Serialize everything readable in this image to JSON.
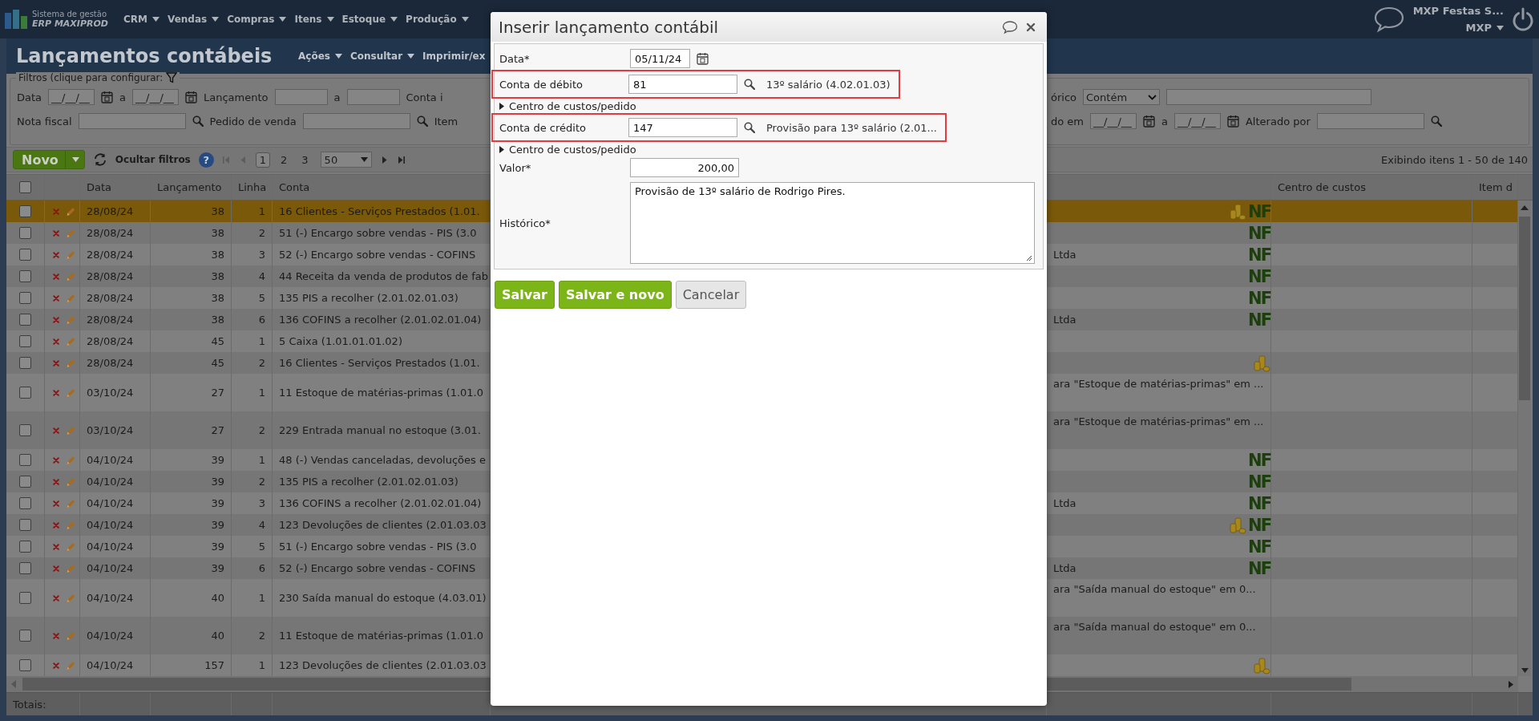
{
  "top_bar": {
    "logo_caption": "Sistema de gestão",
    "logo_name": "ERP MAXIPROD",
    "menu": [
      {
        "label": "CRM"
      },
      {
        "label": "Vendas"
      },
      {
        "label": "Compras"
      },
      {
        "label": "Itens"
      },
      {
        "label": "Estoque"
      },
      {
        "label": "Produção"
      }
    ],
    "company": "MXP Festas S...",
    "user": "MXP"
  },
  "page_header": {
    "title": "Lançamentos contábeis",
    "menu": [
      {
        "label": "Ações",
        "dropdown": true
      },
      {
        "label": "Consultar",
        "dropdown": true
      },
      {
        "label": "Imprimir/ex",
        "dropdown": false
      }
    ]
  },
  "filters": {
    "legend": "Filtros (clique para configurar:",
    "row_1": {
      "left": [
        {
          "kind": "label",
          "text": "Data"
        },
        {
          "kind": "date",
          "value": "__/__/__"
        },
        {
          "kind": "label",
          "text": "a"
        },
        {
          "kind": "date",
          "value": "__/__/__"
        },
        {
          "kind": "label",
          "text": "Lançamento"
        },
        {
          "kind": "short_field"
        },
        {
          "kind": "label",
          "text": "a"
        },
        {
          "kind": "short_field"
        },
        {
          "kind": "label",
          "text": "Conta i"
        }
      ],
      "right": [
        {
          "kind": "label",
          "text": "órico"
        },
        {
          "kind": "select",
          "value": "Contém"
        },
        {
          "kind": "wide_field"
        }
      ]
    },
    "row_2": {
      "left": [
        {
          "kind": "label",
          "text": "Nota fiscal"
        },
        {
          "kind": "search_field"
        },
        {
          "kind": "label",
          "text": "Pedido de venda"
        },
        {
          "kind": "search_field"
        },
        {
          "kind": "label",
          "text": "Item"
        }
      ],
      "right": [
        {
          "kind": "label",
          "text": "do em"
        },
        {
          "kind": "date",
          "value": "__/__/__"
        },
        {
          "kind": "label",
          "text": "a"
        },
        {
          "kind": "date",
          "value": "__/__/__"
        },
        {
          "kind": "label",
          "text": "Alterado por"
        },
        {
          "kind": "search_field"
        }
      ]
    }
  },
  "toolbar": {
    "new_button": "Novo",
    "hide_filters": "Ocultar filtros",
    "help": "?",
    "nav_before": [
      {
        "kind": "first",
        "disabled": true
      },
      {
        "kind": "previous",
        "disabled": true
      }
    ],
    "pages": [
      {
        "label": "1",
        "selected": true
      },
      {
        "label": "2",
        "selected": false
      },
      {
        "label": "3",
        "selected": false
      }
    ],
    "page_size": "50",
    "nav_after": [
      {
        "kind": "next",
        "disabled": false
      },
      {
        "kind": "last",
        "disabled": false
      }
    ],
    "summary": "Exibindo itens 1 - 50 de 140"
  },
  "table": {
    "select_all": {
      "checked": false
    },
    "columns": [
      {
        "label": "Data"
      },
      {
        "label": "Lançamento"
      },
      {
        "label": "Linha"
      },
      {
        "label": "Conta"
      },
      {
        "label": "Centro de custos"
      },
      {
        "label": "Item d"
      }
    ],
    "rows": [
      {
        "checked": false,
        "selected": true,
        "wrapped": false,
        "date": "28/08/24",
        "entry": "38",
        "line": "1",
        "account": "16 Clientes - Serviços Prestados (1.01.",
        "coins": true,
        "badge": "NF"
      },
      {
        "checked": false,
        "selected": false,
        "wrapped": false,
        "date": "28/08/24",
        "entry": "38",
        "line": "2",
        "account": "51 (-) Encargo sobre vendas - PIS (3.0",
        "coins": false,
        "badge": "NF"
      },
      {
        "checked": false,
        "selected": false,
        "wrapped": false,
        "date": "28/08/24",
        "entry": "38",
        "line": "3",
        "account": "52 (-) Encargo sobre vendas - COFINS",
        "column_7": "Ltda",
        "coins": false,
        "badge": "NF"
      },
      {
        "checked": false,
        "selected": false,
        "wrapped": false,
        "date": "28/08/24",
        "entry": "38",
        "line": "4",
        "account": "44 Receita da venda de produtos de fab",
        "coins": false,
        "badge": "NF"
      },
      {
        "checked": false,
        "selected": false,
        "wrapped": false,
        "date": "28/08/24",
        "entry": "38",
        "line": "5",
        "account": "135 PIS a recolher (2.01.02.01.03)",
        "coins": false,
        "badge": "NF"
      },
      {
        "checked": false,
        "selected": false,
        "wrapped": false,
        "date": "28/08/24",
        "entry": "38",
        "line": "6",
        "account": "136 COFINS a recolher (2.01.02.01.04)",
        "column_7": "Ltda",
        "coins": false,
        "badge": "NF"
      },
      {
        "checked": false,
        "selected": false,
        "wrapped": false,
        "date": "28/08/24",
        "entry": "45",
        "line": "1",
        "account": "5 Caixa (1.01.01.01.02)",
        "coins": false
      },
      {
        "checked": false,
        "selected": false,
        "wrapped": false,
        "date": "28/08/24",
        "entry": "45",
        "line": "2",
        "account": "16 Clientes - Serviços Prestados (1.01.",
        "coins": true
      },
      {
        "checked": false,
        "selected": false,
        "wrapped": true,
        "date": "03/10/24",
        "entry": "27",
        "line": "1",
        "account": "11 Estoque de matérias-primas (1.01.0",
        "column_7": "ara \"Estoque de matérias-primas\" em ...",
        "coins": false
      },
      {
        "checked": false,
        "selected": false,
        "wrapped": true,
        "date": "03/10/24",
        "entry": "27",
        "line": "2",
        "account": "229 Entrada manual no estoque (3.01.",
        "column_7": "ara \"Estoque de matérias-primas\" em ...",
        "coins": false
      },
      {
        "checked": false,
        "selected": false,
        "wrapped": false,
        "date": "04/10/24",
        "entry": "39",
        "line": "1",
        "account": "48 (-) Vendas canceladas, devoluções e",
        "coins": false,
        "badge": "NF"
      },
      {
        "checked": false,
        "selected": false,
        "wrapped": false,
        "date": "04/10/24",
        "entry": "39",
        "line": "2",
        "account": "135 PIS a recolher (2.01.02.01.03)",
        "coins": false,
        "badge": "NF"
      },
      {
        "checked": false,
        "selected": false,
        "wrapped": false,
        "date": "04/10/24",
        "entry": "39",
        "line": "3",
        "account": "136 COFINS a recolher (2.01.02.01.04)",
        "column_7": "Ltda",
        "coins": false,
        "badge": "NF"
      },
      {
        "checked": false,
        "selected": false,
        "wrapped": false,
        "date": "04/10/24",
        "entry": "39",
        "line": "4",
        "account": "123 Devoluções de clientes (2.01.03.03",
        "coins": true,
        "badge": "NF"
      },
      {
        "checked": false,
        "selected": false,
        "wrapped": false,
        "date": "04/10/24",
        "entry": "39",
        "line": "5",
        "account": "51 (-) Encargo sobre vendas - PIS (3.0",
        "coins": false,
        "badge": "NF"
      },
      {
        "checked": false,
        "selected": false,
        "wrapped": false,
        "date": "04/10/24",
        "entry": "39",
        "line": "6",
        "account": "52 (-) Encargo sobre vendas - COFINS",
        "column_7": "Ltda",
        "coins": false,
        "badge": "NF"
      },
      {
        "checked": false,
        "selected": false,
        "wrapped": true,
        "date": "04/10/24",
        "entry": "40",
        "line": "1",
        "account": "230 Saída manual do estoque (4.03.01)",
        "column_7": "ara \"Saída manual do estoque\" em 0...",
        "coins": false
      },
      {
        "checked": false,
        "selected": false,
        "wrapped": true,
        "date": "04/10/24",
        "entry": "40",
        "line": "2",
        "account": "11 Estoque de matérias-primas (1.01.0",
        "column_7": "ara \"Saída manual do estoque\" em 0...",
        "coins": false
      },
      {
        "checked": false,
        "selected": false,
        "wrapped": false,
        "date": "04/10/24",
        "entry": "157",
        "line": "1",
        "account": "123 Devoluções de clientes (2.01.03.03",
        "coins": true
      }
    ],
    "footer": "Totais:"
  },
  "dialog": {
    "title": "Inserir lançamento contábil",
    "fields": [
      {
        "kind": "date",
        "label": "Data*",
        "value": "05/11/24"
      },
      {
        "kind": "lookup",
        "label": "Conta de débito",
        "value": "81",
        "description": "13º salário (4.02.01.03)",
        "highlighted": true
      },
      {
        "kind": "toggle",
        "label": "Centro de custos/pedido",
        "expanded": false
      },
      {
        "kind": "lookup",
        "label": "Conta de crédito",
        "value": "147",
        "description": "Provisão para 13º salário (2.01...",
        "highlighted": true
      },
      {
        "kind": "toggle",
        "label": "Centro de custos/pedido",
        "expanded": false
      },
      {
        "kind": "number",
        "label": "Valor*",
        "value": "200,00"
      },
      {
        "kind": "textarea",
        "label": "Histórico*",
        "value": "Provisão de 13º salário de Rodrigo Pires."
      }
    ],
    "buttons": [
      {
        "label": "Salvar",
        "kind": "primary"
      },
      {
        "label": "Salvar e novo",
        "kind": "primary"
      },
      {
        "label": "Cancelar",
        "kind": "secondary"
      }
    ]
  }
}
